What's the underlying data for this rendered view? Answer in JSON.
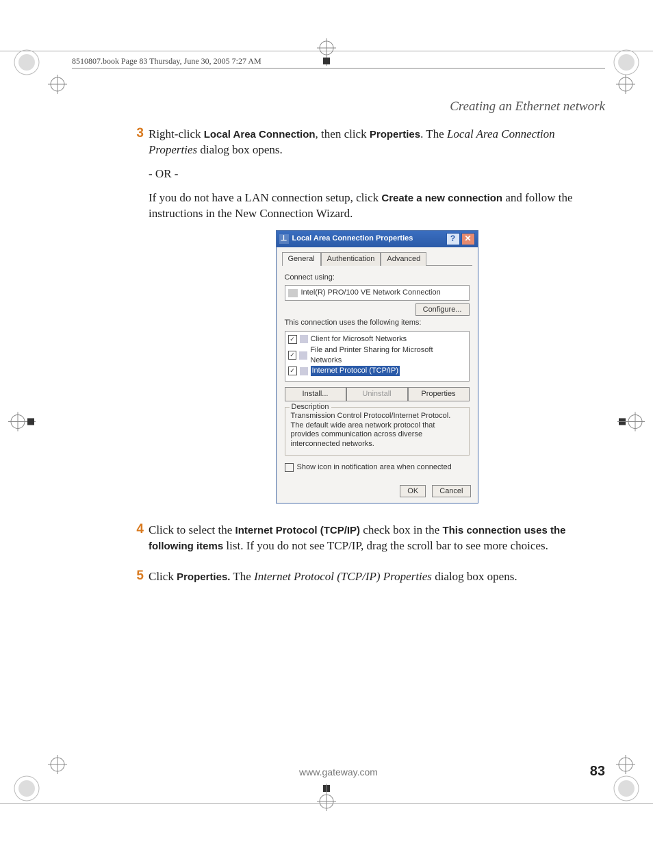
{
  "book_header": "8510807.book  Page 83  Thursday, June 30, 2005  7:27 AM",
  "section_title": "Creating an Ethernet network",
  "steps": {
    "s3": {
      "num": "3",
      "p1_pre": "Right-click ",
      "p1_b1": "Local Area Connection",
      "p1_mid1": ", then click ",
      "p1_b2": "Properties",
      "p1_mid2": ". The ",
      "p1_i1": "Local Area Connection Properties",
      "p1_post": " dialog box opens.",
      "or": "- OR -",
      "p2_pre": "If you do not have a LAN connection setup, click ",
      "p2_b1": "Create a new connection",
      "p2_post": " and follow the instructions in the New Connection Wizard."
    },
    "s4": {
      "num": "4",
      "pre": "Click to select the ",
      "b1": "Internet Protocol (TCP/IP)",
      "mid1": " check box in the ",
      "b2": "This connection uses the following items",
      "post": " list. If you do not see TCP/IP, drag the scroll bar to see more choices."
    },
    "s5": {
      "num": "5",
      "pre": "Click ",
      "b1": "Properties.",
      "mid": " The ",
      "i1": "Internet Protocol (TCP/IP) Properties",
      "post": " dialog box opens."
    }
  },
  "dialog": {
    "title": "Local Area Connection Properties",
    "help": "?",
    "close": "✕",
    "tabs": {
      "general": "General",
      "auth": "Authentication",
      "adv": "Advanced"
    },
    "connect_label": "Connect using:",
    "adapter": "Intel(R) PRO/100 VE Network Connection",
    "configure": "Configure...",
    "items_label": "This connection uses the following items:",
    "items": {
      "i1": "Client for Microsoft Networks",
      "i2": "File and Printer Sharing for Microsoft Networks",
      "i3": "Internet Protocol (TCP/IP)"
    },
    "check": "✓",
    "install": "Install...",
    "uninstall": "Uninstall",
    "properties": "Properties",
    "desc_title": "Description",
    "desc": "Transmission Control Protocol/Internet Protocol. The default wide area network protocol that provides communication across diverse interconnected networks.",
    "show_icon": "Show icon in notification area when connected",
    "ok": "OK",
    "cancel": "Cancel"
  },
  "footer_url": "www.gateway.com",
  "page_number": "83"
}
